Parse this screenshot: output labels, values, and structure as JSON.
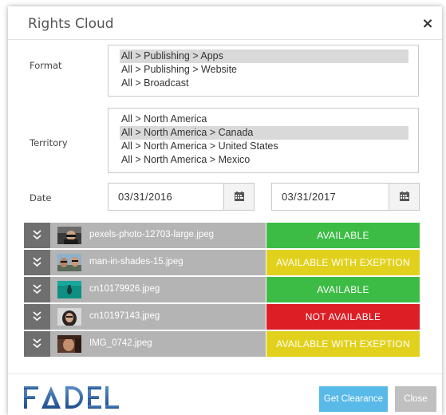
{
  "dialog": {
    "title": "Rights Cloud",
    "close_glyph": "×"
  },
  "format": {
    "label": "Format",
    "options": [
      "All > Publishing > Apps",
      "All > Publishing > Website",
      "All > Broadcast"
    ],
    "selected_index": 0
  },
  "territory": {
    "label": "Territory",
    "options": [
      "All > North America",
      "All > North America > Canada",
      "All > North America > United States",
      "All > North America > Mexico"
    ],
    "selected_index": 1
  },
  "date": {
    "label": "Date",
    "start": "03/31/2016",
    "end": "03/31/2017",
    "icon": "calendar-icon"
  },
  "status_colors": {
    "available": "#3dbc45",
    "exception": "#e2d11c",
    "not_available": "#dc1e25"
  },
  "assets": [
    {
      "filename": "pexels-photo-12703-large.jpeg",
      "status": "AVAILABLE",
      "status_type": "available"
    },
    {
      "filename": "man-in-shades-15.jpeg",
      "status": "AVAILABLE WITH EXEPTION",
      "status_type": "exception"
    },
    {
      "filename": "cn10179926.jpeg",
      "status": "AVAILABLE",
      "status_type": "available"
    },
    {
      "filename": "cn10197143.jpeg",
      "status": "NOT AVAILABLE",
      "status_type": "not_available"
    },
    {
      "filename": "IMG_0742.jpeg",
      "status": "AVAILABLE WITH EXEPTION",
      "status_type": "exception"
    }
  ],
  "logo": {
    "text": "FADEL"
  },
  "buttons": {
    "get_clearance": "Get Clearance",
    "close": "Close"
  }
}
